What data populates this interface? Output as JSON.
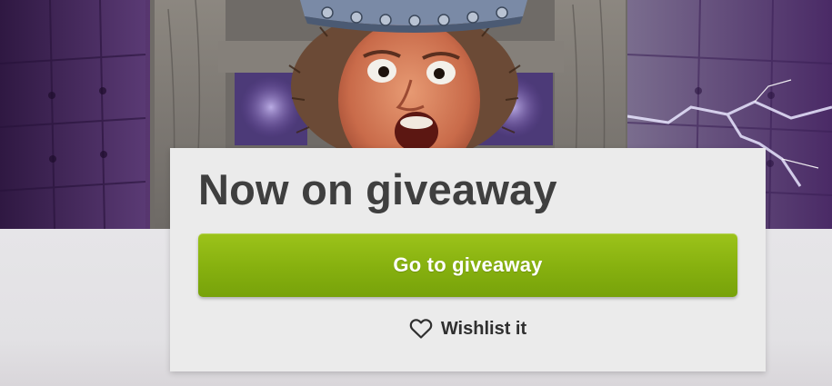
{
  "giveaway": {
    "title": "Now on giveaway",
    "cta_label": "Go to giveaway",
    "wishlist_label": "Wishlist it",
    "wishlist_icon": "heart-outline-icon"
  },
  "colors": {
    "cta_green": "#86b00f",
    "card_bg": "#ebebeb",
    "title_text": "#3f3f3f",
    "hero_purple": "#4d2b63"
  }
}
